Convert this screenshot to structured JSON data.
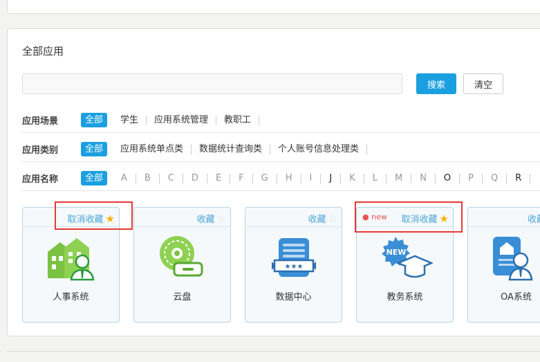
{
  "section_title": "全部应用",
  "search": {
    "placeholder": "",
    "value": "",
    "search_label": "搜索",
    "clear_label": "清空"
  },
  "filters": {
    "scene": {
      "label": "应用场景",
      "items": [
        "全部",
        "学生",
        "应用系统管理",
        "教职工"
      ]
    },
    "category": {
      "label": "应用类别",
      "items": [
        "全部",
        "应用系统单点类",
        "数据统计查询类",
        "个人账号信息处理类"
      ]
    },
    "name": {
      "label": "应用名称",
      "items": [
        "全部",
        "A",
        "B",
        "C",
        "D",
        "E",
        "F",
        "G",
        "H",
        "I",
        "J",
        "K",
        "L",
        "M",
        "N",
        "O",
        "P",
        "Q",
        "R"
      ]
    }
  },
  "apps": [
    {
      "name": "人事系统",
      "fav_label": "取消收藏",
      "favorited": true,
      "is_new": false,
      "icon": "hr-system-icon"
    },
    {
      "name": "云盘",
      "fav_label": "收藏",
      "favorited": false,
      "is_new": false,
      "icon": "cloud-disk-icon"
    },
    {
      "name": "数据中心",
      "fav_label": "收藏",
      "favorited": false,
      "is_new": false,
      "icon": "data-center-icon"
    },
    {
      "name": "教务系统",
      "fav_label": "取消收藏",
      "favorited": true,
      "is_new": true,
      "new_label": "new",
      "icon": "academic-system-icon"
    },
    {
      "name": "OA系统",
      "fav_label": "收藏",
      "favorited": false,
      "is_new": false,
      "icon": "oa-system-icon"
    }
  ],
  "colors": {
    "accent": "#1a9fe0",
    "highlight_box": "#e53935",
    "star_on": "#f5b400",
    "green_icon": "#7cc242",
    "blue_icon": "#3a8ed6"
  }
}
